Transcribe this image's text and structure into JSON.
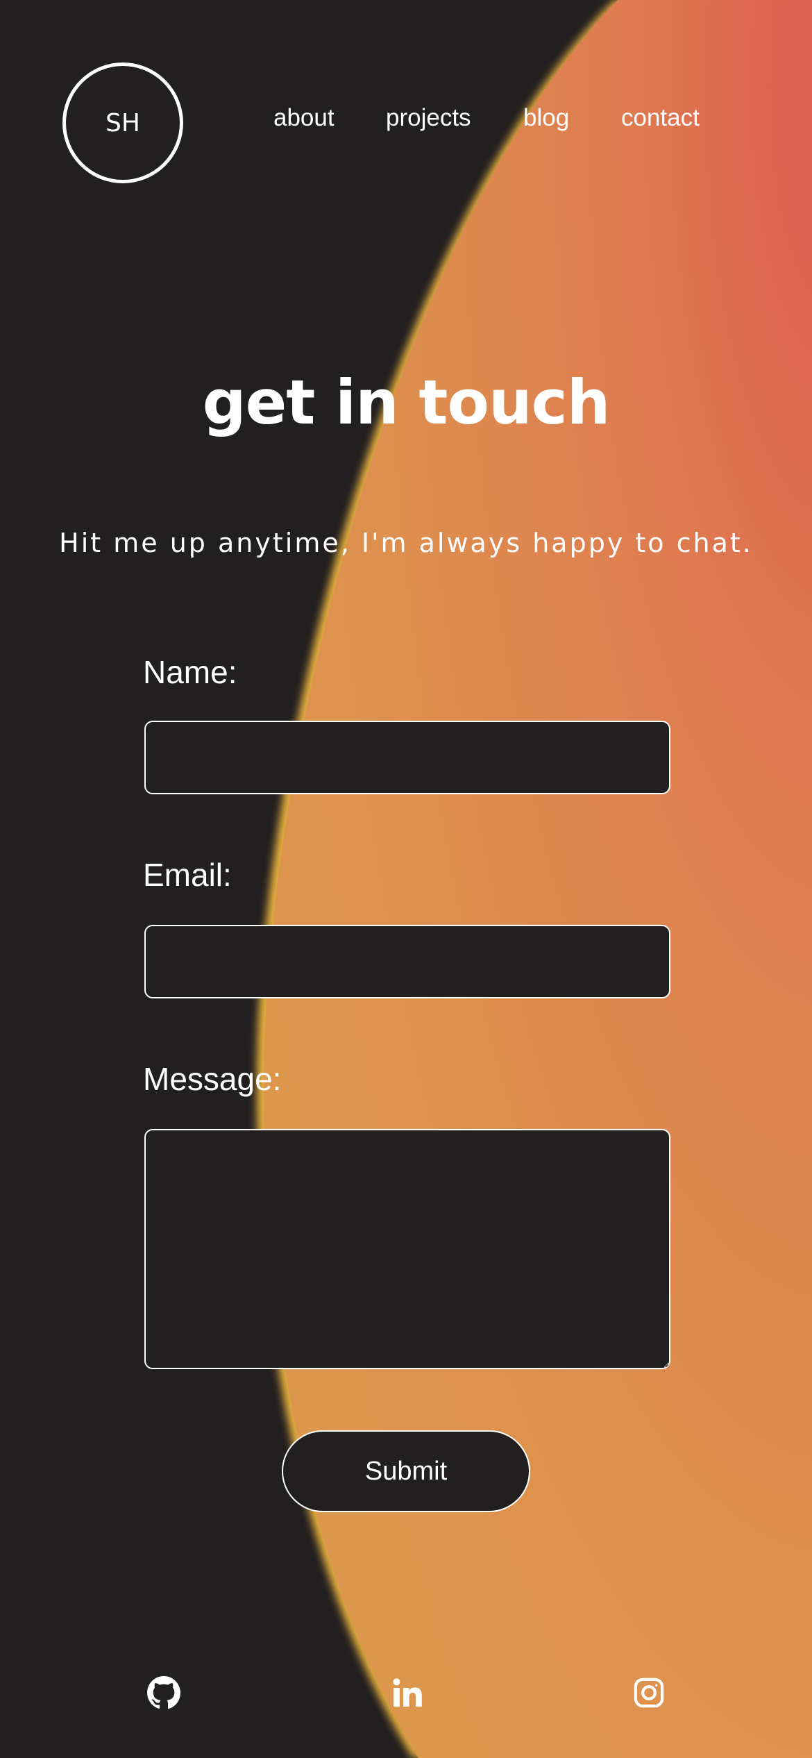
{
  "header": {
    "logo_text": "SH",
    "nav": [
      {
        "label": "about"
      },
      {
        "label": "projects"
      },
      {
        "label": "blog"
      },
      {
        "label": "contact"
      }
    ]
  },
  "main": {
    "title": "get in touch",
    "subtitle": "Hit me up anytime, I'm always happy to chat."
  },
  "form": {
    "name_label": "Name:",
    "name_value": "",
    "email_label": "Email:",
    "email_value": "",
    "message_label": "Message:",
    "message_value": "",
    "submit_label": "Submit"
  },
  "footer": {
    "social": [
      {
        "icon": "github-icon"
      },
      {
        "icon": "linkedin-icon"
      },
      {
        "icon": "instagram-icon"
      }
    ]
  },
  "colors": {
    "background": "#221f20",
    "accent_orange": "#dd8f4f",
    "accent_red": "#de5a4f",
    "accent_yellow": "#e9b13e",
    "text": "#ffffff"
  }
}
